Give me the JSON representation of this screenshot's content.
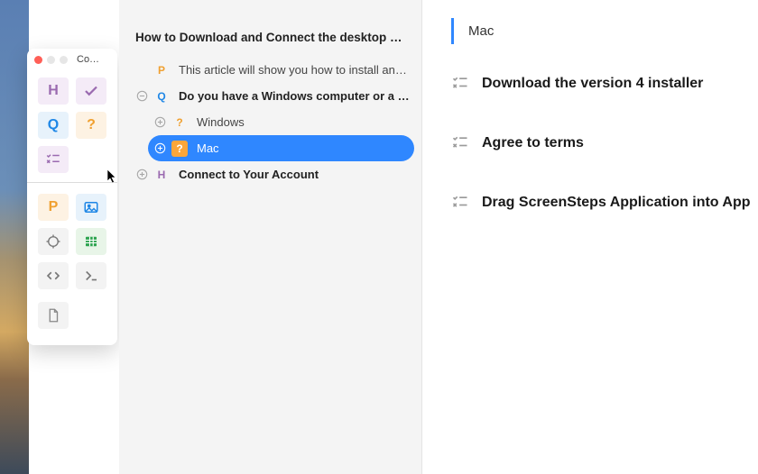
{
  "palette": {
    "title": "Co…",
    "tools_top": [
      {
        "key": "h",
        "label": "H"
      },
      {
        "key": "check",
        "label": "✓"
      },
      {
        "key": "q",
        "label": "Q"
      },
      {
        "key": "qmark",
        "label": "?"
      },
      {
        "key": "list",
        "label": ""
      }
    ],
    "tools_bottom": [
      {
        "key": "p",
        "label": "P"
      },
      {
        "key": "img",
        "label": ""
      },
      {
        "key": "target",
        "label": ""
      },
      {
        "key": "grid",
        "label": ""
      },
      {
        "key": "code",
        "label": ""
      },
      {
        "key": "term",
        "label": ""
      },
      {
        "key": "file",
        "label": ""
      }
    ]
  },
  "outline": {
    "title": "How to Download and Connect the desktop sof…",
    "items": [
      {
        "depth": 0,
        "badge": "P",
        "badge_color": "#f0a030",
        "label": "This article will show you how to install and co…",
        "bold": false,
        "selected": false,
        "expander": ""
      },
      {
        "depth": 0,
        "badge": "Q",
        "badge_color": "#1f87e6",
        "label": "Do you have a Windows computer or a M…",
        "bold": true,
        "selected": false,
        "expander": "minus"
      },
      {
        "depth": 1,
        "badge": "?",
        "badge_color": "#f0a030",
        "label": "Windows",
        "bold": false,
        "selected": false,
        "expander": "plus"
      },
      {
        "depth": 1,
        "badge": "?",
        "badge_color": "#f0a030",
        "label": "Mac",
        "bold": false,
        "selected": true,
        "expander": "plus"
      },
      {
        "depth": 0,
        "badge": "H",
        "badge_color": "#9a6ab0",
        "label": "Connect to Your Account",
        "bold": true,
        "selected": false,
        "expander": "plus"
      }
    ]
  },
  "content": {
    "header": "Mac",
    "steps": [
      {
        "title": "Download  the version 4 installer"
      },
      {
        "title": "Agree to terms"
      },
      {
        "title": "Drag ScreenSteps Application into App"
      }
    ]
  }
}
